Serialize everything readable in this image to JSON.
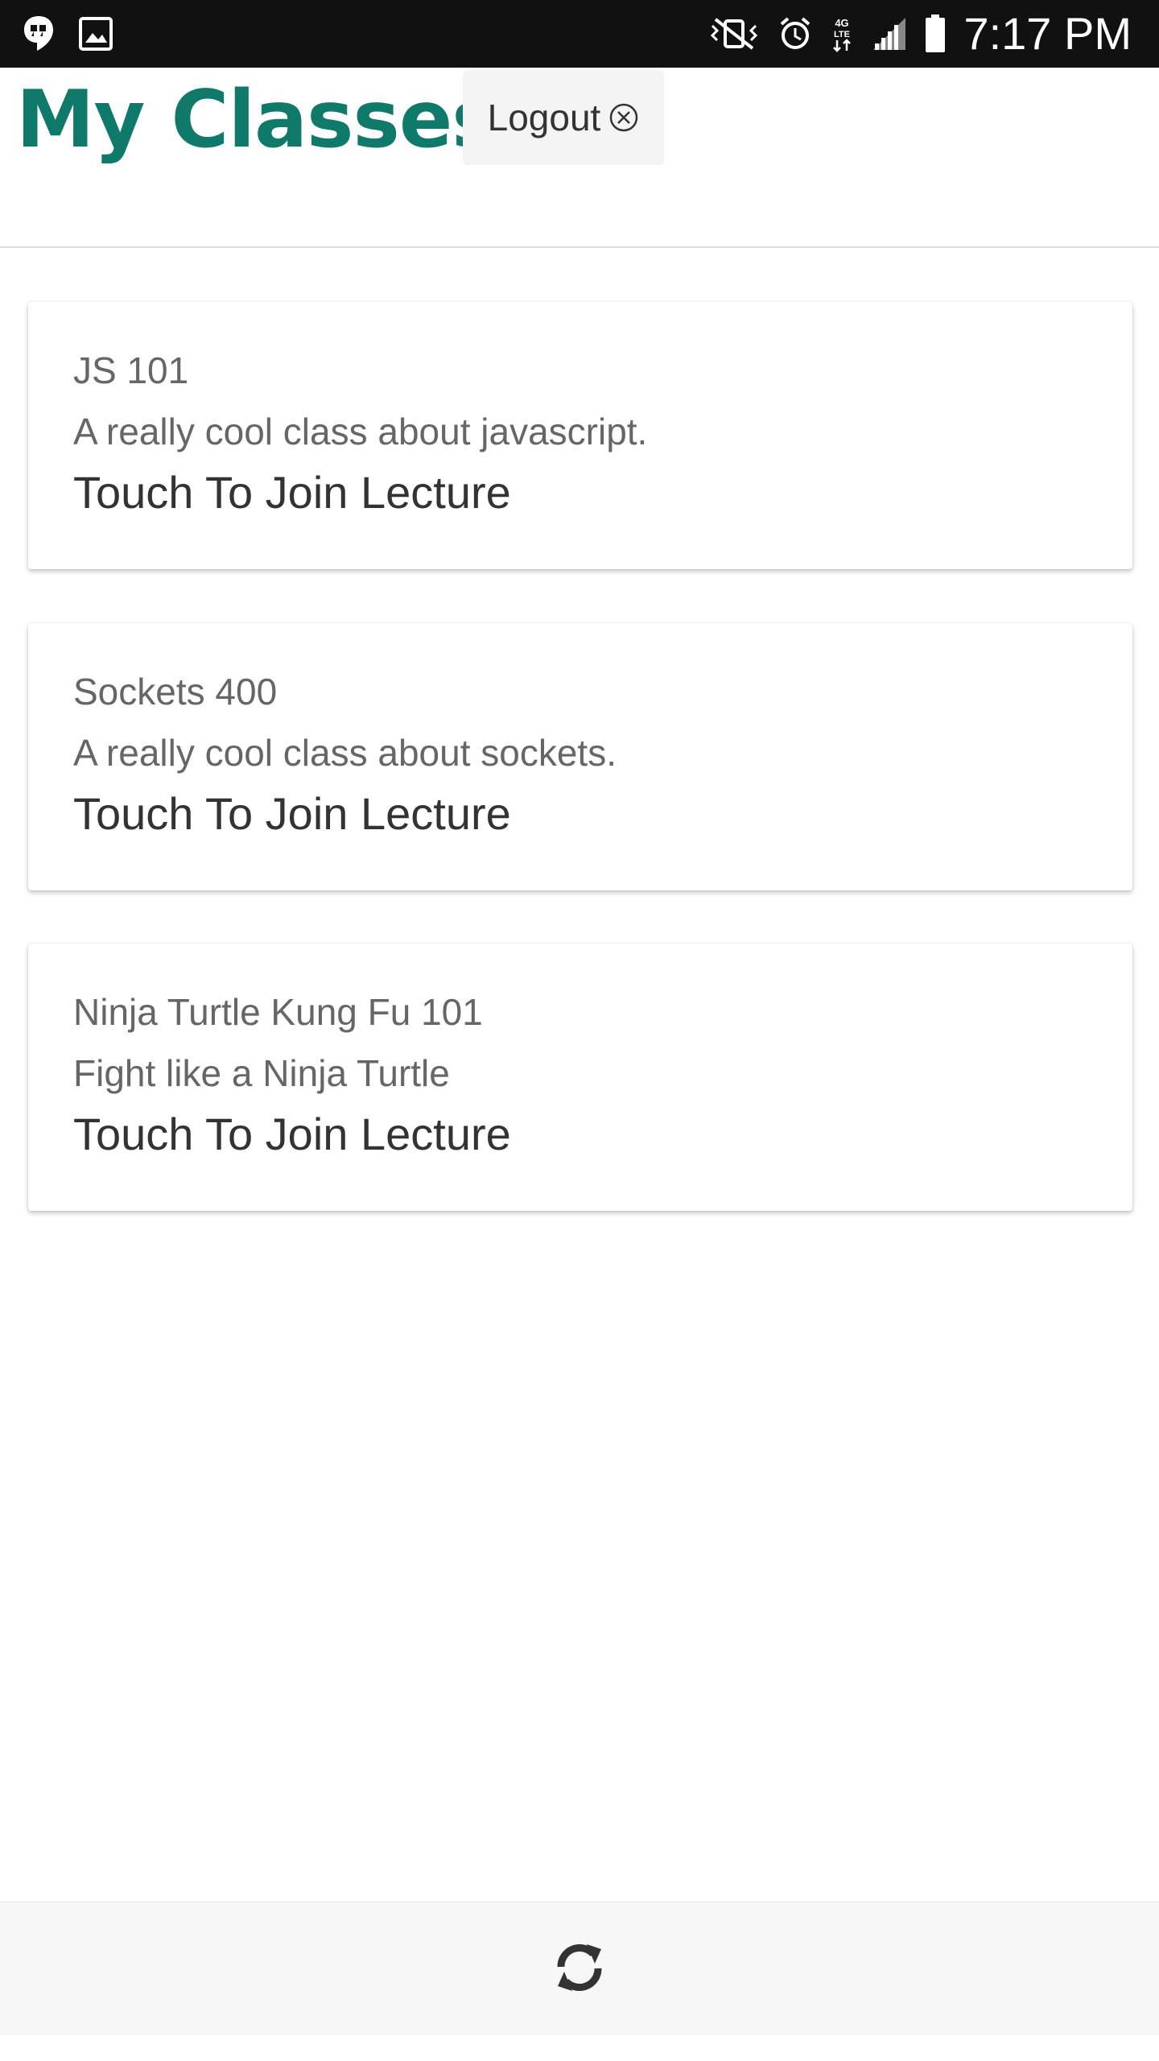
{
  "status_bar": {
    "time": "7:17 PM",
    "left_icons": [
      "hangouts-icon",
      "image-icon"
    ],
    "right_icons": [
      "mute-vibrate-icon",
      "alarm-icon",
      "lte-icon",
      "signal-icon",
      "battery-icon"
    ]
  },
  "header": {
    "title": "My Classes",
    "logout_label": "Logout"
  },
  "classes": [
    {
      "title": "JS 101",
      "description": "A really cool class about javascript.",
      "action": "Touch To Join Lecture"
    },
    {
      "title": "Sockets 400",
      "description": "A really cool class about sockets.",
      "action": "Touch To Join Lecture"
    },
    {
      "title": "Ninja Turtle Kung Fu 101",
      "description": "Fight like a Ninja Turtle",
      "action": "Touch To Join Lecture"
    }
  ],
  "footer": {
    "icon": "refresh-icon"
  },
  "colors": {
    "title": "#0f7a6a",
    "status_bar": "#111111",
    "footer": "#f7f7f7"
  }
}
